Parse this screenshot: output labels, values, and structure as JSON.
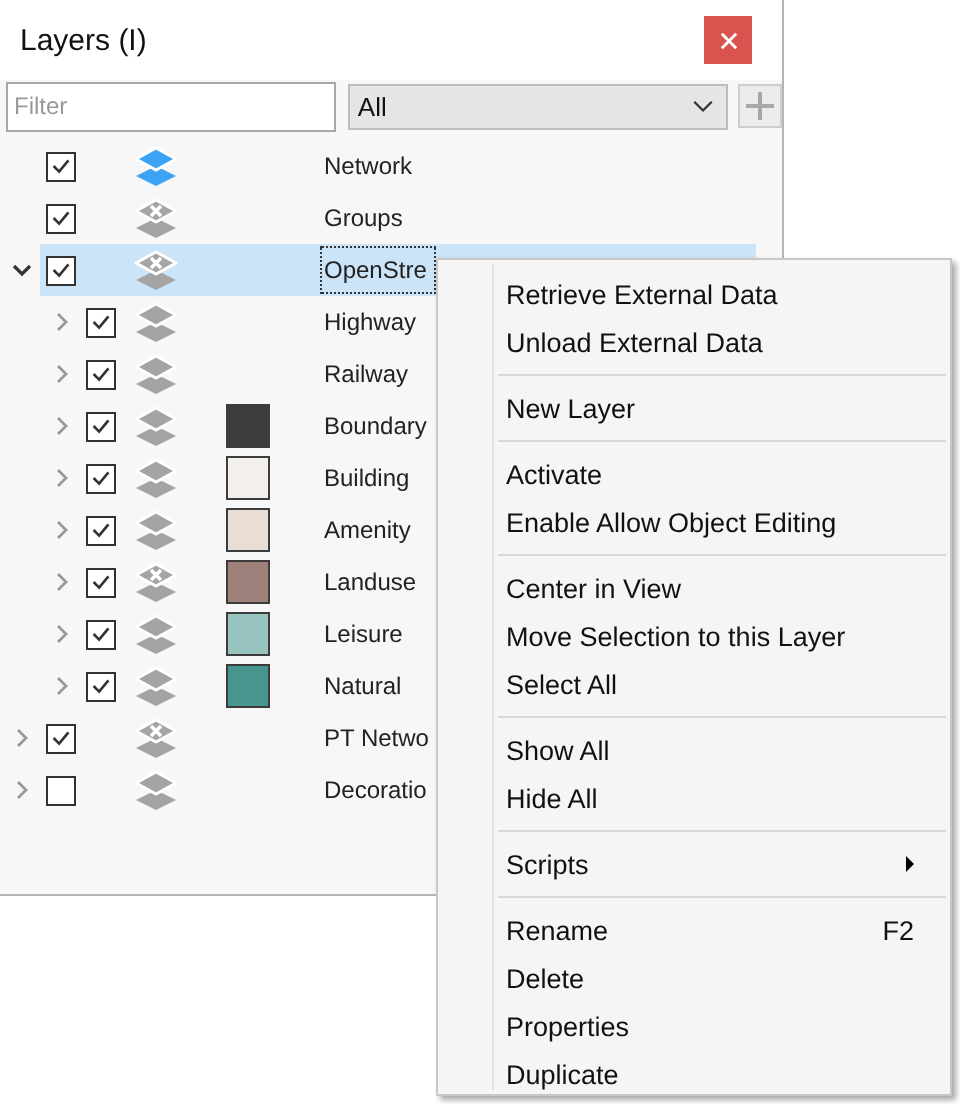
{
  "window": {
    "title": "Layers (I)"
  },
  "filter": {
    "placeholder": "Filter"
  },
  "type_select": {
    "value": "All"
  },
  "add_button": {
    "disabled": true
  },
  "tree": [
    {
      "label": "Network",
      "kind": "layer",
      "active": true,
      "checked": true,
      "selected": false
    },
    {
      "label": "Groups",
      "kind": "group",
      "active": false,
      "checked": true,
      "selected": false
    },
    {
      "label": "OpenStre",
      "kind": "group",
      "active": false,
      "checked": true,
      "selected": true,
      "expanded": true,
      "children": [
        {
          "label": "Highway",
          "kind": "layer",
          "active": false,
          "checked": true,
          "selected": false,
          "expanded": false
        },
        {
          "label": "Railway",
          "kind": "layer",
          "active": false,
          "checked": true,
          "selected": false,
          "expanded": false
        },
        {
          "label": "Boundary",
          "kind": "layer",
          "active": false,
          "checked": true,
          "selected": false,
          "expanded": false,
          "color": "#3c3c3c"
        },
        {
          "label": "Building",
          "kind": "layer",
          "active": false,
          "checked": true,
          "selected": false,
          "expanded": false,
          "color": "#f3f0eb"
        },
        {
          "label": "Amenity",
          "kind": "layer",
          "active": false,
          "checked": true,
          "selected": false,
          "expanded": false,
          "color": "#e8ded6"
        },
        {
          "label": "Landuse",
          "kind": "group",
          "active": false,
          "checked": true,
          "selected": false,
          "expanded": false,
          "color": "#9f817c"
        },
        {
          "label": "Leisure",
          "kind": "layer",
          "active": false,
          "checked": true,
          "selected": false,
          "expanded": false,
          "color": "#98c4bf"
        },
        {
          "label": "Natural",
          "kind": "layer",
          "active": false,
          "checked": true,
          "selected": false,
          "expanded": false,
          "color": "#46968f"
        }
      ]
    },
    {
      "label": "PT Netwo",
      "kind": "group",
      "active": false,
      "checked": true,
      "selected": false,
      "expanded": false
    },
    {
      "label": "Decoratio",
      "kind": "layer",
      "active": false,
      "checked": false,
      "selected": false,
      "expanded": false
    }
  ],
  "context_menu": [
    {
      "kind": "item",
      "label": "Retrieve External Data",
      "submenu": false
    },
    {
      "kind": "item",
      "label": "Unload External Data",
      "submenu": false
    },
    {
      "kind": "separator"
    },
    {
      "kind": "item",
      "label": "New Layer",
      "submenu": false
    },
    {
      "kind": "separator"
    },
    {
      "kind": "item",
      "label": "Activate",
      "submenu": false
    },
    {
      "kind": "item",
      "label": "Enable Allow Object Editing",
      "submenu": false
    },
    {
      "kind": "separator"
    },
    {
      "kind": "item",
      "label": "Center in View",
      "submenu": false
    },
    {
      "kind": "item",
      "label": "Move Selection to this Layer",
      "submenu": false
    },
    {
      "kind": "item",
      "label": "Select All",
      "submenu": false
    },
    {
      "kind": "separator"
    },
    {
      "kind": "item",
      "label": "Show All",
      "submenu": false
    },
    {
      "kind": "item",
      "label": "Hide All",
      "submenu": false
    },
    {
      "kind": "separator"
    },
    {
      "kind": "item",
      "label": "Scripts",
      "submenu": true
    },
    {
      "kind": "separator"
    },
    {
      "kind": "item",
      "label": "Rename",
      "shortcut": "F2",
      "submenu": false
    },
    {
      "kind": "item",
      "label": "Delete",
      "submenu": false
    },
    {
      "kind": "item",
      "label": "Properties",
      "submenu": false
    },
    {
      "kind": "item",
      "label": "Duplicate",
      "submenu": false
    }
  ]
}
